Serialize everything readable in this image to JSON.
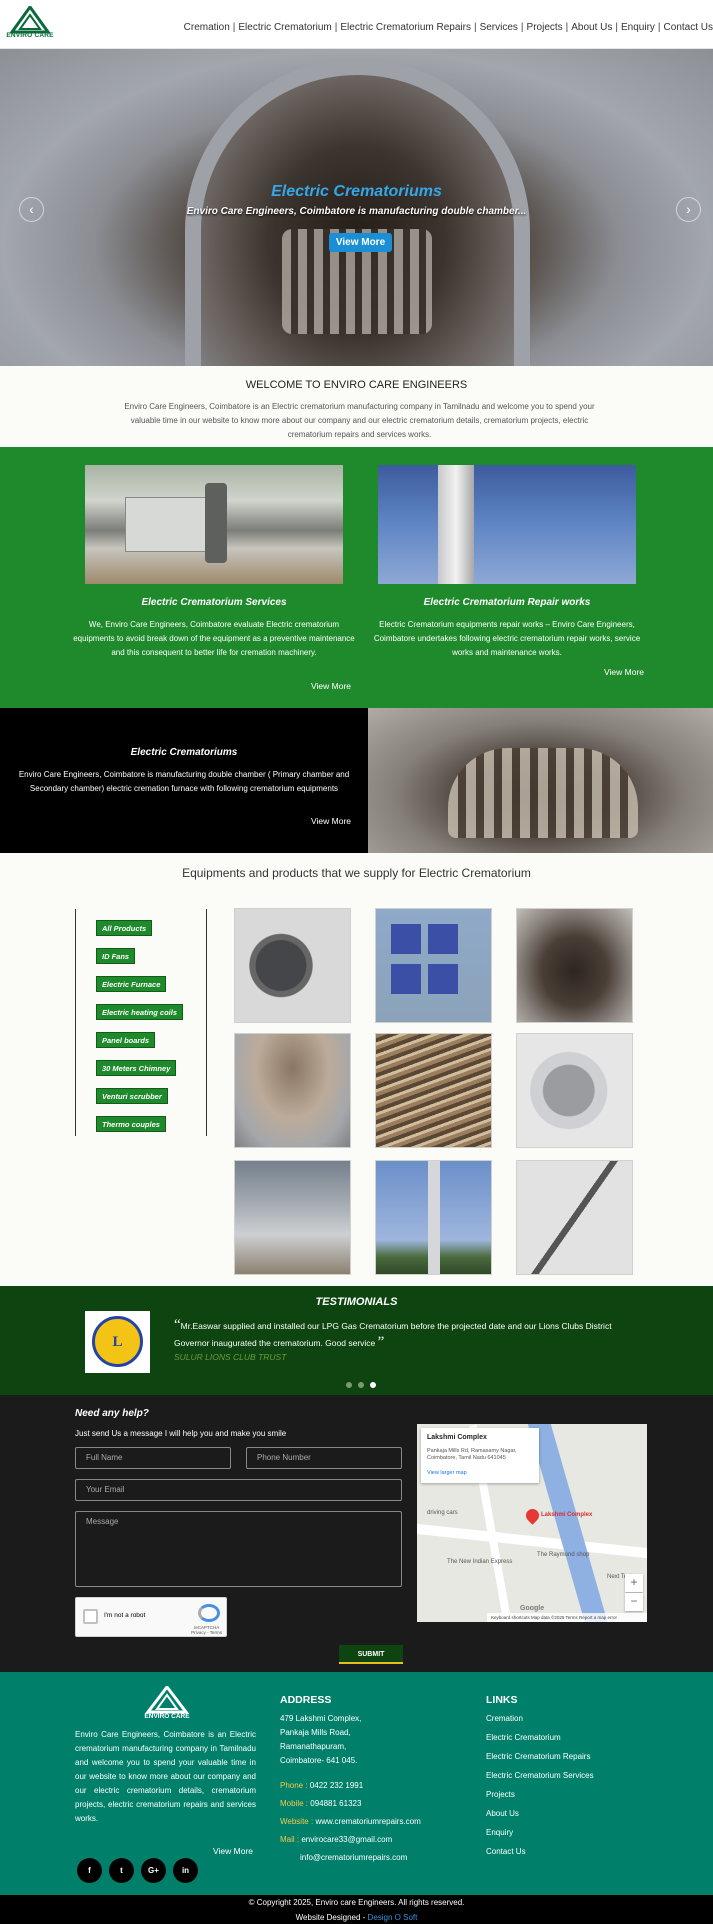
{
  "header": {
    "logo_text": "ENVIRO CARE",
    "nav": [
      "Cremation",
      "Electric Crematorium",
      "Electric Crematorium Repairs",
      "Services",
      "Projects",
      "About Us",
      "Enquiry",
      "Contact Us"
    ]
  },
  "hero": {
    "title": "Electric Crematoriums",
    "subtitle": "Enviro Care Engineers, Coimbatore is manufacturing double chamber...",
    "button": "View More",
    "prev": "‹",
    "next": "›"
  },
  "welcome": {
    "title": "WELCOME TO ENVIRO CARE ENGINEERS",
    "text": "Enviro Care Engineers, Coimbatore is an Electric crematorium manufacturing company in Tamilnadu and welcome you to spend your valuable time in our website to know more about our company and our electric crematorium details, crematorium projects, electric crematorium repairs and services works."
  },
  "services": [
    {
      "title": "Electric Crematorium Services",
      "text": "We, Enviro Care Engineers, Coimbatore evaluate Electric crematorium equipments to avoid break down of the equipment as a preventive maintenance and this consequent to better life for cremation machinery.",
      "more": "View More"
    },
    {
      "title": "Electric Crematorium Repair works",
      "text": "Electric Crematorium equipments repair works – Enviro Care Engineers, Coimbatore undertakes following electric crematorium repair works, service works and maintenance works.",
      "more": "View More"
    }
  ],
  "crematoriums": {
    "title": "Electric Crematoriums",
    "text": "Enviro Care Engineers, Coimbatore is manufacturing double chamber ( Primary chamber and Secondary chamber) electric cremation furnace with following crematorium equipments",
    "more": "View More"
  },
  "products": {
    "title": "Equipments and products that we supply for Electric Crematorium",
    "tags": [
      "All Products",
      "ID Fans",
      "Electric Furnace",
      "Electric heating coils",
      "Panel boards",
      "30 Meters Chimney",
      "Venturi scrubber",
      "Thermo couples"
    ]
  },
  "testimonials": {
    "title": "TESTIMONIALS",
    "quote_open": "“",
    "quote_close": "”",
    "text": "Mr.Easwar supplied and installed our LPG Gas Crematorium before the projected date and our Lions Clubs District Governor inaugurated the crematorium. Good service",
    "author": "SULUR LIONS CLUB TRUST",
    "logo_text": "L"
  },
  "contact": {
    "title": "Need any help?",
    "subtitle": "Just send Us a message I will help you and make you smile",
    "full_name_placeholder": "Full Name",
    "phone_placeholder": "Phone Number",
    "email_placeholder": "Your Email",
    "message_placeholder": "Message",
    "captcha_label": "I'm not a robot",
    "captcha_brand": "reCAPTCHA",
    "captcha_terms": "Privacy - Terms",
    "submit": "SUBMIT",
    "map": {
      "place": "Lakshmi Complex",
      "address": "Pankaja Mills Rd, Ramasamy Nagar, Coimbatore, Tamil Nadu 641045",
      "larger_map": "View larger map",
      "marker_label": "Lakshmi Complex",
      "labels": [
        "driving cars",
        "The New Indian Express",
        "The Raymond shop",
        "Next Techno"
      ],
      "zoom_in": "+",
      "zoom_out": "−",
      "google": "Google",
      "footer": "Keyboard shortcuts   Map data ©2025   Terms   Report a map error"
    }
  },
  "footer": {
    "logo_text": "ENVIRO CARE",
    "about": "Enviro Care Engineers, Coimbatore is an Electric crematorium manufacturing company in Tamilnadu and welcome you to spend your valuable time in our website to know more about our company and our electric crematorium details, crematorium projects, electric crematorium repairs and services works.",
    "more": "View More",
    "social": [
      "f",
      "t",
      "G+",
      "in"
    ],
    "address_title": "ADDRESS",
    "address_lines": [
      "479 Lakshmi Complex,",
      "Pankaja Mills Road,",
      "Ramanathapuram,",
      "Coimbatore- 641 045."
    ],
    "phone_label": "Phone :",
    "phone": "0422 232 1991",
    "mobile_label": "Mobile :",
    "mobile": "094881 61323",
    "website_label": "Website :",
    "website": "www.crematoriumrepairs.com",
    "mail_label": "Mail :",
    "mail1": "envirocare33@gmail.com",
    "mail2": "info@crematoriumrepairs.com",
    "links_title": "LINKS",
    "links": [
      "Cremation",
      "Electric Crematorium",
      "Electric Crematorium Repairs",
      "Electric Crematorium Services",
      "Projects",
      "About Us",
      "Enquiry",
      "Contact Us"
    ],
    "copyright": "© Copyright 2025, Enviro care Engineers. All rights reserved.",
    "designed_label": "Website Designed -",
    "designed_by": "Design O Soft"
  },
  "colors": {
    "brand_green": "#1f8a2c",
    "dark_green": "#0d440f",
    "footer_teal": "#00806a",
    "hero_title_blue": "#35a7e8",
    "button_blue": "#1b8fd6"
  }
}
